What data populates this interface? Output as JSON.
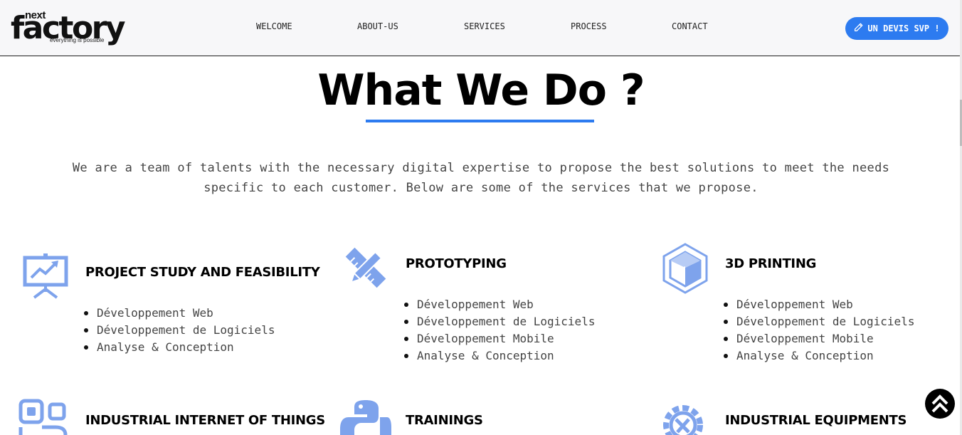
{
  "brand": {
    "logo_top": "next",
    "logo_main": "factory",
    "logo_tagline": "everything is possible"
  },
  "nav": [
    {
      "label": "WELCOME"
    },
    {
      "label": "ABOUT-US"
    },
    {
      "label": "SERVICES"
    },
    {
      "label": "PROCESS"
    },
    {
      "label": "CONTACT"
    }
  ],
  "cta": {
    "label": "UN DEVIS SVP !",
    "icon": "pencil-icon",
    "color": "#2d7bf0"
  },
  "hero": {
    "title": "What We Do ?",
    "intro_line1": "We are a team of talents with the necessary digital expertise to propose the best solutions to meet the needs",
    "intro_line2": "specific to each customer. Below are some of the services that we propose."
  },
  "colors": {
    "accent": "#2d7bf0",
    "icon_blue": "#7ea3ec"
  },
  "services": [
    {
      "title": "PROJECT STUDY AND FEASIBILITY",
      "icon": "presentation-board-icon",
      "items": [
        "Développement Web",
        "Développement de Logiciels",
        "Analyse & Conception"
      ]
    },
    {
      "title": "PROTOTYPING",
      "icon": "ruler-pencil-icon",
      "items": [
        "Développement Web",
        "Développement de Logiciels",
        "Développement Mobile",
        "Analyse & Conception"
      ]
    },
    {
      "title": "3D PRINTING",
      "icon": "cube-icon",
      "items": [
        "Développement Web",
        "Développement de Logiciels",
        "Développement Mobile",
        "Analyse & Conception"
      ]
    },
    {
      "title": "INDUSTRIAL INTERNET OF THINGS",
      "icon": "circuit-icon",
      "items": []
    },
    {
      "title": "TRAININGS",
      "icon": "python-icon",
      "items": []
    },
    {
      "title": "INDUSTRIAL EQUIPMENTS",
      "icon": "gear-wrench-icon",
      "items": []
    }
  ],
  "back_to_top": {
    "icon": "double-chevron-up-icon"
  }
}
